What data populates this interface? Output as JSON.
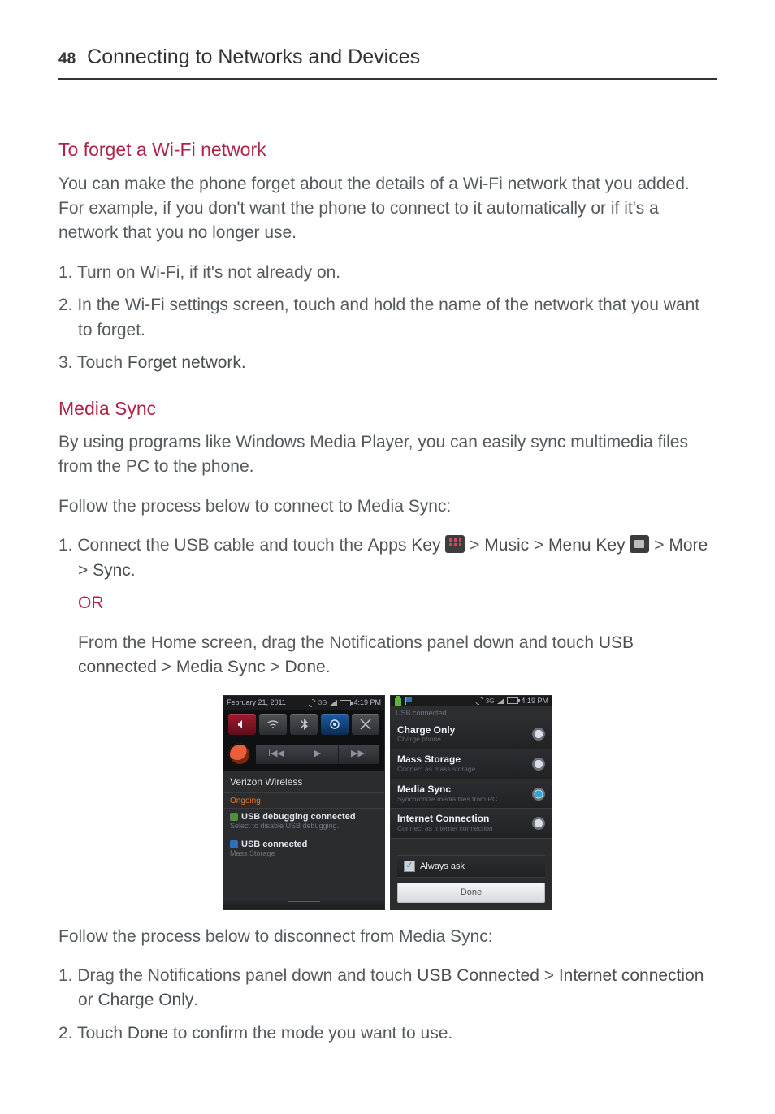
{
  "header": {
    "page_number": "48",
    "chapter": "Connecting to Networks and Devices"
  },
  "section1": {
    "title": "To forget a Wi-Fi network",
    "intro": "You can make the phone forget about the details of a Wi-Fi network that you added. For example, if you don't want the phone to connect to it automatically or if it's a network that you no longer use.",
    "step1": "1. Turn on Wi-Fi, if it's not already on.",
    "step2": "2. In the Wi-Fi settings screen, touch and hold the name of the network that you want to forget.",
    "step3_prefix": "3. Touch ",
    "step3_bold": "Forget network."
  },
  "section2": {
    "title": "Media Sync",
    "p1": "By using programs like Windows Media Player, you can easily sync multimedia files from the PC to the phone.",
    "p2": "Follow the process below to connect to Media Sync:",
    "step1": {
      "t0": "1. Connect the USB cable and touch the ",
      "b1": "Apps Key ",
      "t1": " > ",
      "b2": "Music",
      "t2": " > ",
      "b3": "Menu Key ",
      "t3": " > ",
      "b4": "More",
      "t4": " > ",
      "b5": "Sync",
      "t5": "."
    },
    "or": "OR",
    "or_body_pre": "From the Home screen, drag the Notifications panel down and touch ",
    "or_b1": "USB connected",
    "or_t1": " > ",
    "or_b2": "Media Sync",
    "or_t2": " > ",
    "or_b3": "Done",
    "or_t3": ".",
    "p3": "Follow the process below to disconnect from Media Sync:",
    "step_d1": {
      "t0": "1. Drag the Notifications panel down and touch ",
      "b1": "USB Connected",
      "t1": " > ",
      "b2": "Internet connection",
      "t2": " or ",
      "b3": "Charge Only",
      "t3": "."
    },
    "step_d2": {
      "t0": "2. Touch ",
      "b1": "Done",
      "t1": " to confirm the mode you want to use."
    }
  },
  "shots": {
    "left": {
      "date": "February 21, 2011",
      "time": "4:19 PM",
      "mc_prev": "I◀◀",
      "mc_play": "▶",
      "mc_next": "▶▶I",
      "carrier": "Verizon Wireless",
      "ongoing": "Ongoing",
      "n1_title": "USB debugging connected",
      "n1_sub": "Select to disable USB debugging.",
      "n2_title": "USB connected",
      "n2_sub": "Mass Storage"
    },
    "right": {
      "time": "4:19 PM",
      "usb_bar": "USB connected",
      "opts": [
        {
          "title": "Charge Only",
          "sub": "Charge phone"
        },
        {
          "title": "Mass Storage",
          "sub": "Connect as mass storage"
        },
        {
          "title": "Media Sync",
          "sub": "Synchronize media files from PC"
        },
        {
          "title": "Internet Connection",
          "sub": "Connect as Internet connection"
        }
      ],
      "always": "Always ask",
      "done": "Done"
    }
  }
}
